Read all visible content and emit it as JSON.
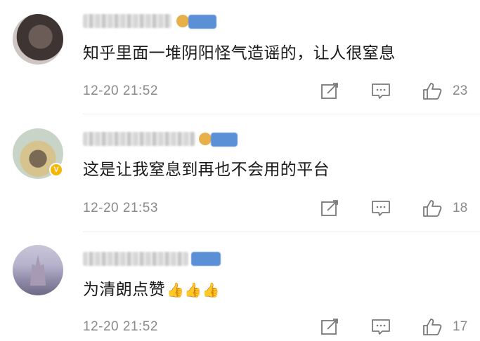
{
  "comments": [
    {
      "text": "知乎里面一堆阴阳怪气造谣的，让人很窒息",
      "time": "12-20 21:52",
      "likes": "23",
      "verified": false
    },
    {
      "text": "这是让我窒息到再也不会用的平台",
      "time": "12-20 21:53",
      "likes": "18",
      "verified": true
    },
    {
      "text": "为清朗点赞",
      "emoji": "👍👍👍",
      "time": "12-20 21:52",
      "likes": "17",
      "verified": false
    }
  ],
  "icons": {
    "share": "share-icon",
    "comment": "comment-icon",
    "like": "thumbs-up-icon",
    "verified": "verified-badge-icon"
  },
  "colors": {
    "text": "#1a1a1a",
    "meta": "#8a8a8a",
    "verified": "#f7b500",
    "member_badge": "#5b8fd6"
  }
}
